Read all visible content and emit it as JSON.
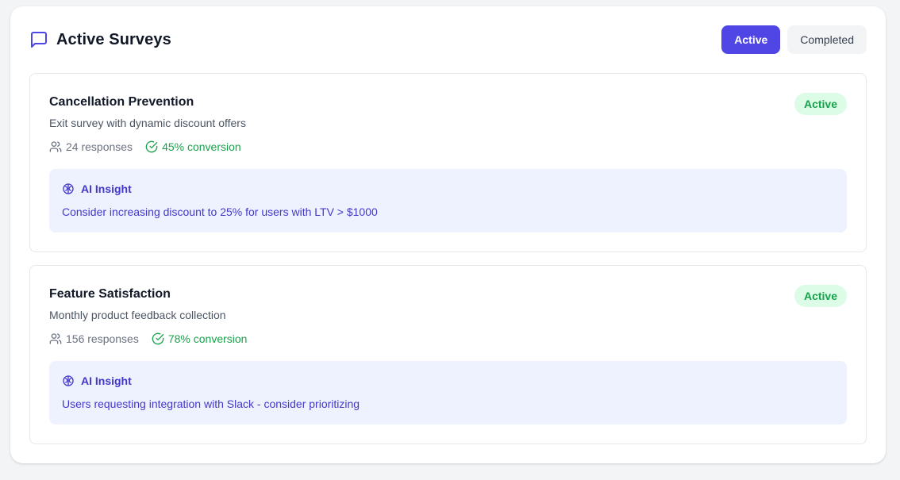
{
  "header": {
    "title": "Active Surveys",
    "icon": "message-square-icon",
    "tabs": [
      {
        "label": "Active",
        "selected": true
      },
      {
        "label": "Completed",
        "selected": false
      }
    ]
  },
  "surveys": [
    {
      "title": "Cancellation Prevention",
      "description": "Exit survey with dynamic discount offers",
      "status": "Active",
      "responses": "24 responses",
      "conversion": "45% conversion",
      "insight_label": "AI Insight",
      "insight_text": "Consider increasing discount to 25% for users with LTV > $1000"
    },
    {
      "title": "Feature Satisfaction",
      "description": "Monthly product feedback collection",
      "status": "Active",
      "responses": "156 responses",
      "conversion": "78% conversion",
      "insight_label": "AI Insight",
      "insight_text": "Users requesting integration with Slack - consider prioritizing"
    }
  ],
  "colors": {
    "accent": "#4f46e5",
    "success": "#16a34a",
    "success_bg": "#dcfce7",
    "insight_bg": "#eef2ff",
    "insight_text": "#4338ca"
  }
}
